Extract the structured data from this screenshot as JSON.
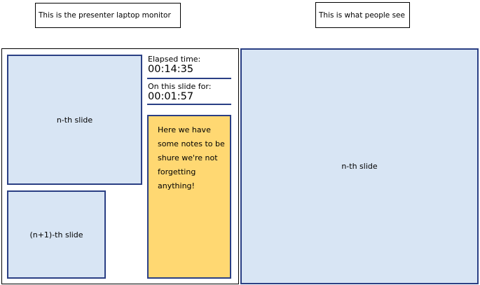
{
  "labels": {
    "presenter": "This is the presenter laptop monitor",
    "audience": "This is what people see"
  },
  "presenter_screen": {
    "current_slide": "n-th slide",
    "next_slide": "(n+1)-th slide",
    "elapsed": {
      "label": "Elapsed time:",
      "value": "00:14:35"
    },
    "on_slide": {
      "label": "On this slide for:",
      "value": "00:01:57"
    },
    "notes": "Here we have some notes to be shure we're not forgetting anything!"
  },
  "audience_screen": {
    "slide": "n-th slide"
  },
  "colors": {
    "slide_fill": "#d8e5f4",
    "slide_border": "#2a3f84",
    "notes_fill": "#ffd872"
  }
}
